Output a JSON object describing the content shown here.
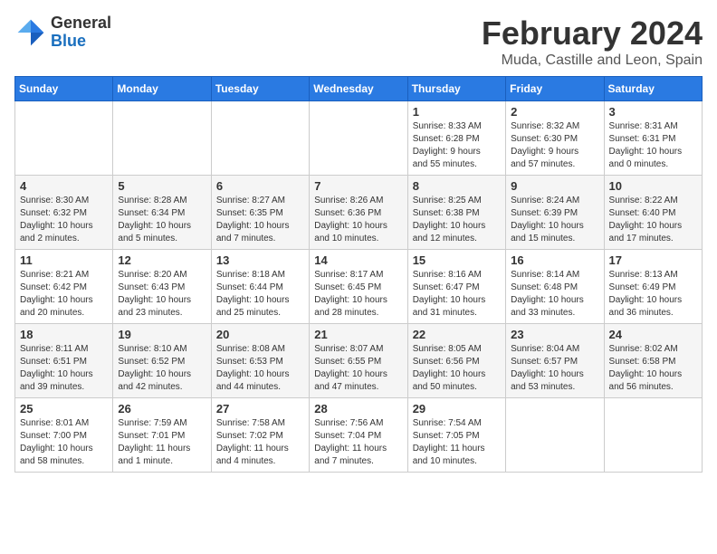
{
  "header": {
    "logo_general": "General",
    "logo_blue": "Blue",
    "month_title": "February 2024",
    "location": "Muda, Castille and Leon, Spain"
  },
  "weekdays": [
    "Sunday",
    "Monday",
    "Tuesday",
    "Wednesday",
    "Thursday",
    "Friday",
    "Saturday"
  ],
  "weeks": [
    [
      {
        "day": "",
        "info": ""
      },
      {
        "day": "",
        "info": ""
      },
      {
        "day": "",
        "info": ""
      },
      {
        "day": "",
        "info": ""
      },
      {
        "day": "1",
        "info": "Sunrise: 8:33 AM\nSunset: 6:28 PM\nDaylight: 9 hours\nand 55 minutes."
      },
      {
        "day": "2",
        "info": "Sunrise: 8:32 AM\nSunset: 6:30 PM\nDaylight: 9 hours\nand 57 minutes."
      },
      {
        "day": "3",
        "info": "Sunrise: 8:31 AM\nSunset: 6:31 PM\nDaylight: 10 hours\nand 0 minutes."
      }
    ],
    [
      {
        "day": "4",
        "info": "Sunrise: 8:30 AM\nSunset: 6:32 PM\nDaylight: 10 hours\nand 2 minutes."
      },
      {
        "day": "5",
        "info": "Sunrise: 8:28 AM\nSunset: 6:34 PM\nDaylight: 10 hours\nand 5 minutes."
      },
      {
        "day": "6",
        "info": "Sunrise: 8:27 AM\nSunset: 6:35 PM\nDaylight: 10 hours\nand 7 minutes."
      },
      {
        "day": "7",
        "info": "Sunrise: 8:26 AM\nSunset: 6:36 PM\nDaylight: 10 hours\nand 10 minutes."
      },
      {
        "day": "8",
        "info": "Sunrise: 8:25 AM\nSunset: 6:38 PM\nDaylight: 10 hours\nand 12 minutes."
      },
      {
        "day": "9",
        "info": "Sunrise: 8:24 AM\nSunset: 6:39 PM\nDaylight: 10 hours\nand 15 minutes."
      },
      {
        "day": "10",
        "info": "Sunrise: 8:22 AM\nSunset: 6:40 PM\nDaylight: 10 hours\nand 17 minutes."
      }
    ],
    [
      {
        "day": "11",
        "info": "Sunrise: 8:21 AM\nSunset: 6:42 PM\nDaylight: 10 hours\nand 20 minutes."
      },
      {
        "day": "12",
        "info": "Sunrise: 8:20 AM\nSunset: 6:43 PM\nDaylight: 10 hours\nand 23 minutes."
      },
      {
        "day": "13",
        "info": "Sunrise: 8:18 AM\nSunset: 6:44 PM\nDaylight: 10 hours\nand 25 minutes."
      },
      {
        "day": "14",
        "info": "Sunrise: 8:17 AM\nSunset: 6:45 PM\nDaylight: 10 hours\nand 28 minutes."
      },
      {
        "day": "15",
        "info": "Sunrise: 8:16 AM\nSunset: 6:47 PM\nDaylight: 10 hours\nand 31 minutes."
      },
      {
        "day": "16",
        "info": "Sunrise: 8:14 AM\nSunset: 6:48 PM\nDaylight: 10 hours\nand 33 minutes."
      },
      {
        "day": "17",
        "info": "Sunrise: 8:13 AM\nSunset: 6:49 PM\nDaylight: 10 hours\nand 36 minutes."
      }
    ],
    [
      {
        "day": "18",
        "info": "Sunrise: 8:11 AM\nSunset: 6:51 PM\nDaylight: 10 hours\nand 39 minutes."
      },
      {
        "day": "19",
        "info": "Sunrise: 8:10 AM\nSunset: 6:52 PM\nDaylight: 10 hours\nand 42 minutes."
      },
      {
        "day": "20",
        "info": "Sunrise: 8:08 AM\nSunset: 6:53 PM\nDaylight: 10 hours\nand 44 minutes."
      },
      {
        "day": "21",
        "info": "Sunrise: 8:07 AM\nSunset: 6:55 PM\nDaylight: 10 hours\nand 47 minutes."
      },
      {
        "day": "22",
        "info": "Sunrise: 8:05 AM\nSunset: 6:56 PM\nDaylight: 10 hours\nand 50 minutes."
      },
      {
        "day": "23",
        "info": "Sunrise: 8:04 AM\nSunset: 6:57 PM\nDaylight: 10 hours\nand 53 minutes."
      },
      {
        "day": "24",
        "info": "Sunrise: 8:02 AM\nSunset: 6:58 PM\nDaylight: 10 hours\nand 56 minutes."
      }
    ],
    [
      {
        "day": "25",
        "info": "Sunrise: 8:01 AM\nSunset: 7:00 PM\nDaylight: 10 hours\nand 58 minutes."
      },
      {
        "day": "26",
        "info": "Sunrise: 7:59 AM\nSunset: 7:01 PM\nDaylight: 11 hours\nand 1 minute."
      },
      {
        "day": "27",
        "info": "Sunrise: 7:58 AM\nSunset: 7:02 PM\nDaylight: 11 hours\nand 4 minutes."
      },
      {
        "day": "28",
        "info": "Sunrise: 7:56 AM\nSunset: 7:04 PM\nDaylight: 11 hours\nand 7 minutes."
      },
      {
        "day": "29",
        "info": "Sunrise: 7:54 AM\nSunset: 7:05 PM\nDaylight: 11 hours\nand 10 minutes."
      },
      {
        "day": "",
        "info": ""
      },
      {
        "day": "",
        "info": ""
      }
    ]
  ]
}
